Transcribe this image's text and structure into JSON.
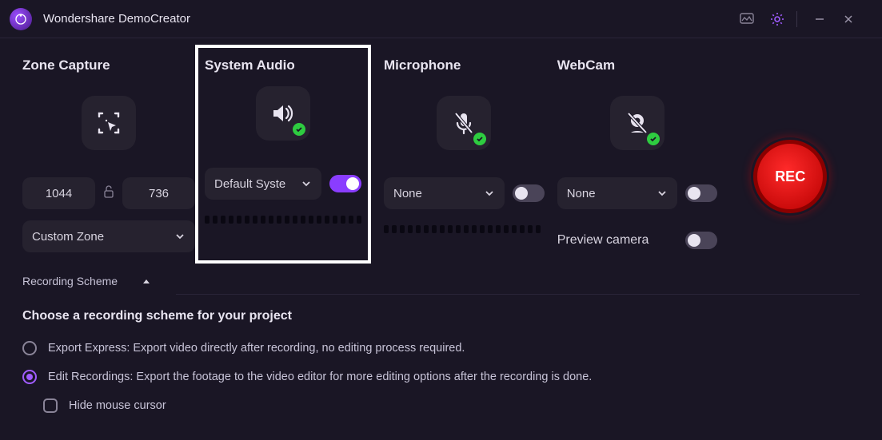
{
  "app": {
    "title": "Wondershare DemoCreator"
  },
  "zone": {
    "title": "Zone Capture",
    "width": "1044",
    "height": "736",
    "mode": "Custom Zone"
  },
  "system_audio": {
    "title": "System Audio",
    "device": "Default Syste",
    "enabled": true
  },
  "microphone": {
    "title": "Microphone",
    "device": "None",
    "enabled": true
  },
  "webcam": {
    "title": "WebCam",
    "device": "None",
    "enabled": true,
    "preview_label": "Preview camera",
    "preview_enabled": false
  },
  "rec_label": "REC",
  "scheme": {
    "header": "Recording Scheme",
    "title": "Choose a recording scheme for your project",
    "options": [
      {
        "label": "Export Express: Export video directly after recording, no editing process required.",
        "selected": false
      },
      {
        "label": "Edit Recordings: Export the footage to the video editor for more editing options after the recording is done.",
        "selected": true
      }
    ],
    "hide_cursor": {
      "label": "Hide mouse cursor",
      "checked": false
    }
  }
}
